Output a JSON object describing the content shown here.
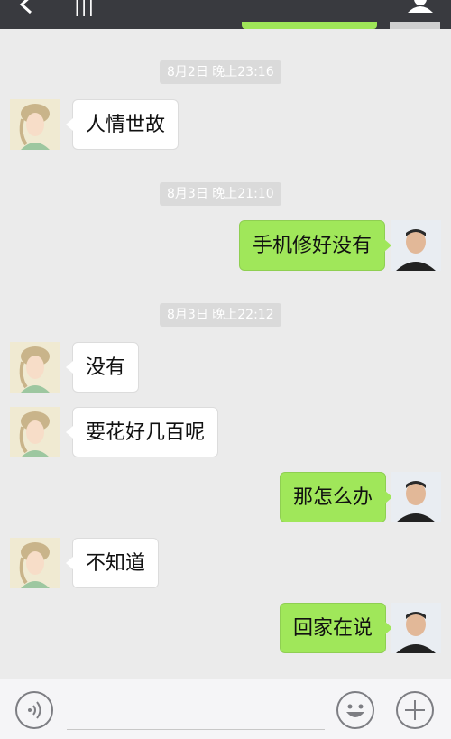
{
  "header": {
    "title_glyph": "|||",
    "back_icon": "back-arrow-icon",
    "profile_icon": "person-icon"
  },
  "messages": [
    {
      "type": "time",
      "text": "8月2日 晚上23:16"
    },
    {
      "type": "msg",
      "side": "left",
      "text": "人情世故"
    },
    {
      "type": "time",
      "text": "8月3日 晚上21:10"
    },
    {
      "type": "msg",
      "side": "right",
      "text": "手机修好没有"
    },
    {
      "type": "time",
      "text": "8月3日 晚上22:12"
    },
    {
      "type": "msg",
      "side": "left",
      "text": "没有"
    },
    {
      "type": "msg",
      "side": "left",
      "text": "要花好几百呢"
    },
    {
      "type": "msg",
      "side": "right",
      "text": "那怎么办"
    },
    {
      "type": "msg",
      "side": "left",
      "text": "不知道"
    },
    {
      "type": "msg",
      "side": "right",
      "text": "回家在说"
    }
  ],
  "input_bar": {
    "voice_icon": "voice-icon",
    "emoji_icon": "emoji-icon",
    "plus_icon": "plus-icon",
    "input_value": ""
  },
  "colors": {
    "background": "#ebebeb",
    "header": "#393a3f",
    "sent_bubble": "#a0e75a",
    "received_bubble": "#ffffff",
    "timestamp_bg": "#dadada"
  }
}
